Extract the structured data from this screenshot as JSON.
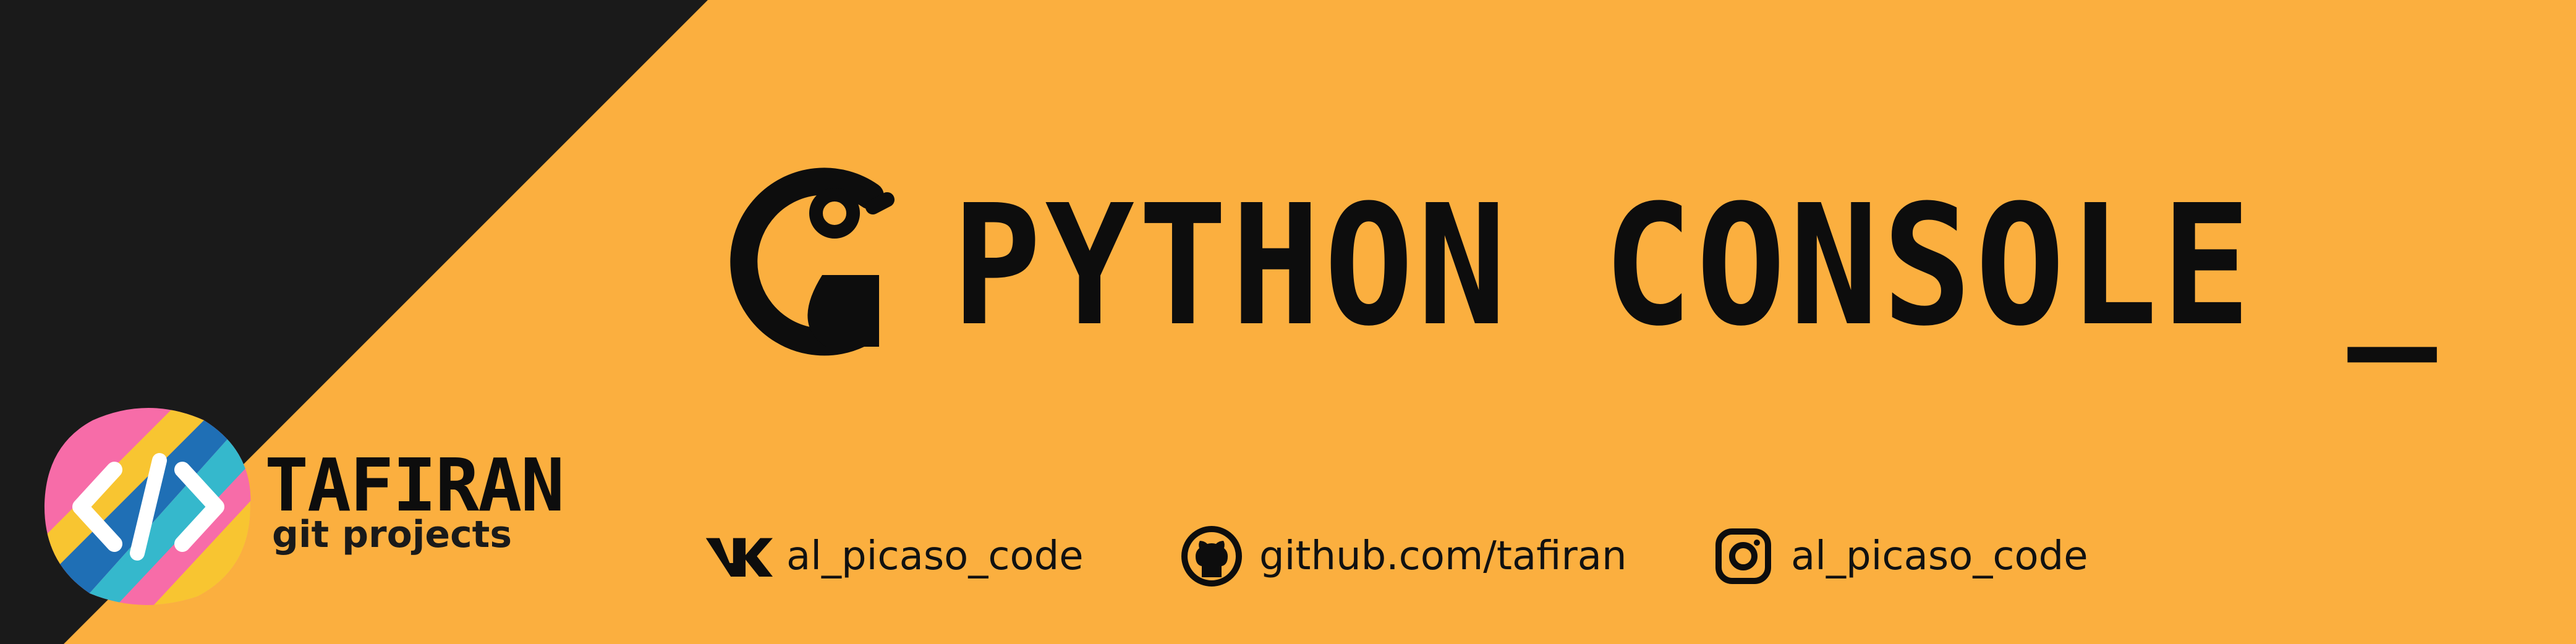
{
  "banner": {
    "title": "PYTHON CONSOLE _",
    "logo_icon": "python-console-g-icon",
    "colors": {
      "background": "#FBAF3F",
      "dark_corner": "#1A1A1A",
      "text": "#0D0D0D"
    }
  },
  "brand": {
    "name": "TAFIRAN",
    "subtitle": "git projects",
    "badge_icon": "code-brackets-icon",
    "badge_colors": [
      "#F76CA8",
      "#F8C531",
      "#1F6FB5",
      "#35B8CC"
    ]
  },
  "social": [
    {
      "icon": "vk-icon",
      "label": "al_picaso_code"
    },
    {
      "icon": "github-icon",
      "label": "github.com/tafiran"
    },
    {
      "icon": "instagram-icon",
      "label": "al_picaso_code"
    }
  ]
}
